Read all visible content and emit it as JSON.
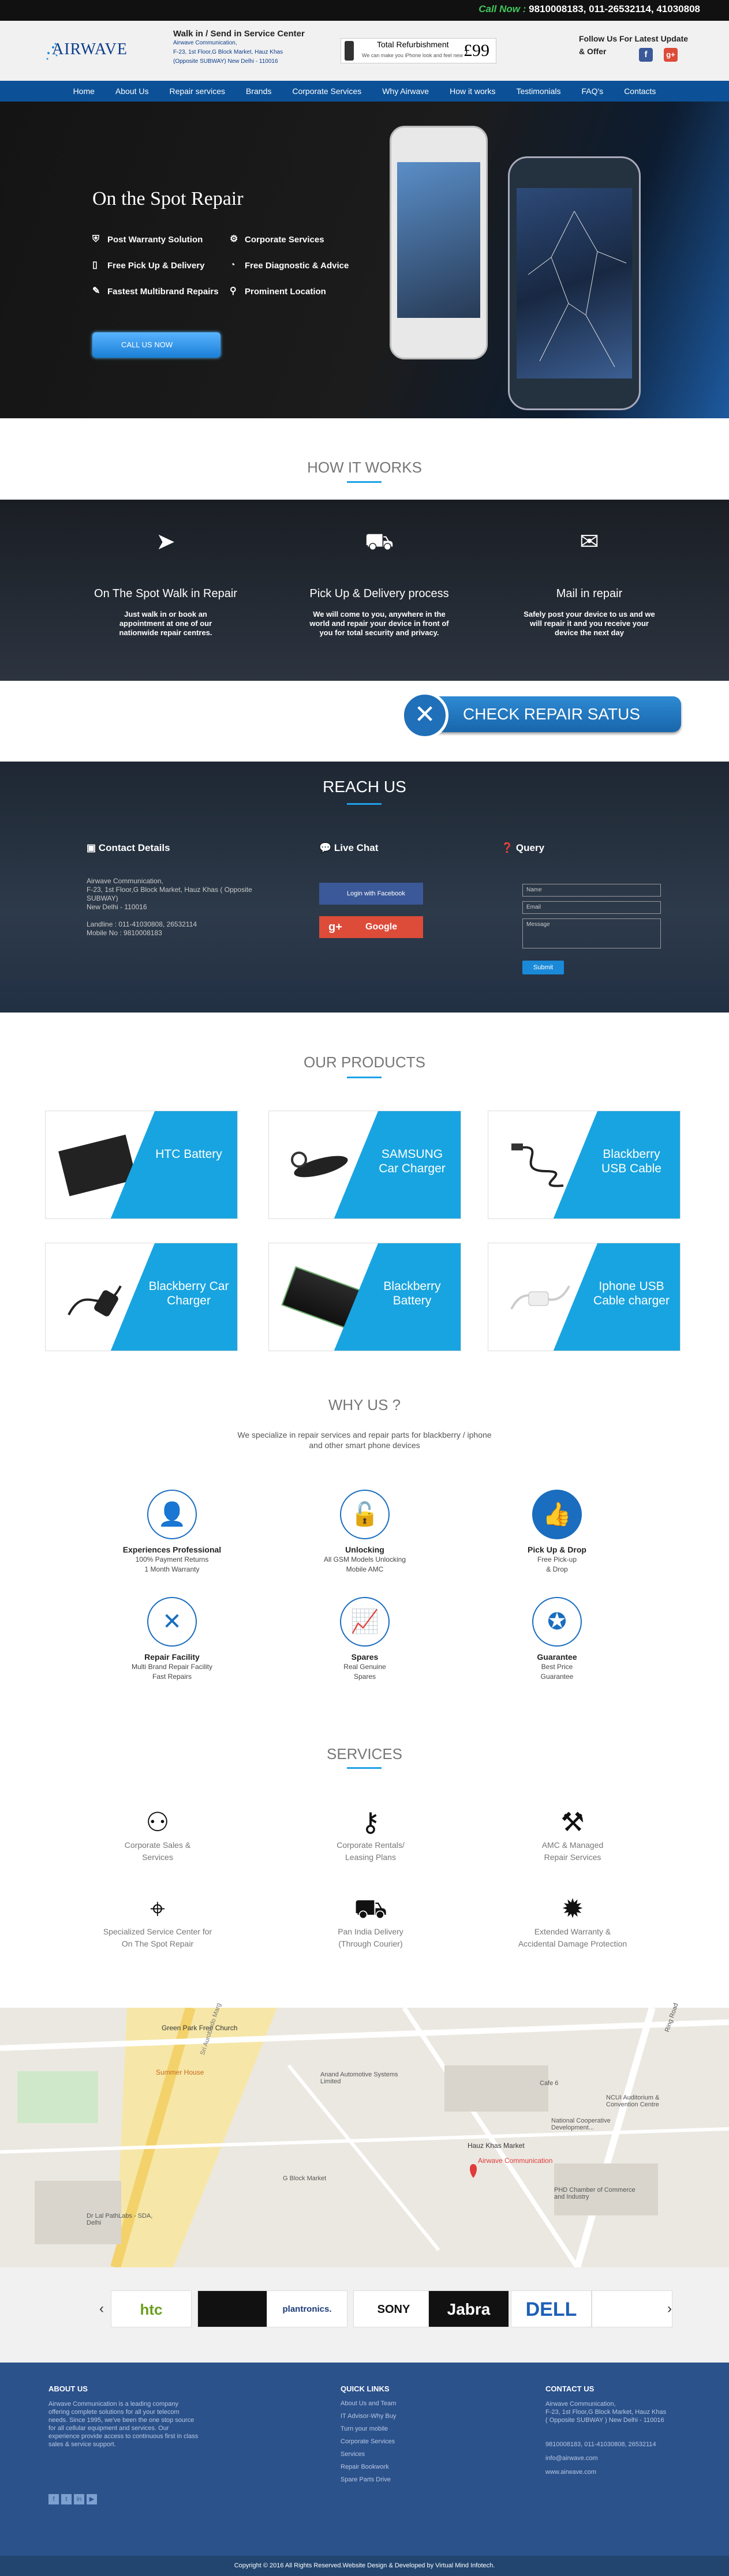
{
  "topbar": {
    "call_label": "Call Now :",
    "call_numbers": "9810008183, 011-26532114, 41030808"
  },
  "header": {
    "logo": "AIRWAVE",
    "walkin_title": "Walk in / Send in Service Center",
    "walkin_line1": "Airwave Communication,",
    "walkin_line2": "F-23, 1st Floor,G Block Market, Hauz Khas",
    "walkin_line3": "(Opposite SUBWAY) New Delhi - 110016",
    "refurb_title": "Total Refurbishment",
    "refurb_sub": "We can make you iPhone look and feel new",
    "refurb_price": "£99",
    "follow1": "Follow Us For Latest Update",
    "follow2": "& Offer",
    "fb": "f",
    "gp": "g+"
  },
  "nav": [
    "Home",
    "About Us",
    "Repair services",
    "Brands",
    "Corporate Services",
    "Why Airwave",
    "How it works",
    "Testimonials",
    "FAQ's",
    "Contacts"
  ],
  "hero": {
    "title": "On the Spot Repair",
    "features": [
      "Post Warranty Solution",
      "Corporate Services",
      "Free Pick Up & Delivery",
      "Free Diagnostic & Advice",
      "Fastest Multibrand Repairs",
      "Prominent Location"
    ],
    "cta": "CALL US NOW"
  },
  "how": {
    "title": "HOW IT WORKS",
    "steps": [
      {
        "title": "On The Spot Walk in Repair",
        "text": "Just walk in or book an appointment at one of our nationwide repair centres."
      },
      {
        "title": "Pick Up & Delivery process",
        "text": "We will come to you, anywhere in the world and repair your device in front of you for total security and privacy."
      },
      {
        "title": "Mail in repair",
        "text": "Safely post your device to us and we will repair it and you receive your device the next day"
      }
    ]
  },
  "check": {
    "label": "CHECK REPAIR SATUS"
  },
  "reach": {
    "title": "REACH US",
    "contact_title": "Contact Details",
    "contact_lines": [
      "Airwave Communication,",
      "F-23, 1st Floor,G Block Market, Hauz Khas ( Opposite",
      "SUBWAY)",
      "New Delhi - 110016",
      "",
      "Landline : 011-41030808, 26532114",
      "Mobile No : 9810008183"
    ],
    "chat_title": "Live Chat",
    "fb_login": "Login with Facebook",
    "google": "Google",
    "query_title": "Query",
    "name_ph": "Name",
    "email_ph": "Email",
    "msg_ph": "Message",
    "submit": "Submit"
  },
  "products": {
    "title": "OUR PRODUCTS",
    "items": [
      "HTC Battery",
      "SAMSUNG Car Charger",
      "Blackberry USB Cable",
      "Blackberry Car Charger",
      "Blackberry Battery",
      "Iphone USB Cable charger"
    ]
  },
  "why": {
    "title": "WHY US ?",
    "intro1": "We specialize in repair services and repair parts for blackberry / iphone",
    "intro2": "and other smart phone devices",
    "items": [
      {
        "title": "Experiences Professional",
        "l1": "100% Payment Returns",
        "l2": "1 Month Warranty"
      },
      {
        "title": "Unlocking",
        "l1": "All GSM Models Unlocking",
        "l2": "Mobile AMC"
      },
      {
        "title": "Pick Up & Drop",
        "l1": "Free Pick-up",
        "l2": "& Drop"
      },
      {
        "title": "Repair Facility",
        "l1": "Multi Brand Repair Facility",
        "l2": "Fast Repairs"
      },
      {
        "title": "Spares",
        "l1": "Real Genuine",
        "l2": "Spares"
      },
      {
        "title": "Guarantee",
        "l1": "Best Price",
        "l2": "Guarantee"
      }
    ]
  },
  "services": {
    "title": "SERVICES",
    "items": [
      {
        "l1": "Corporate Sales &",
        "l2": "Services"
      },
      {
        "l1": "Corporate Rentals/",
        "l2": "Leasing Plans"
      },
      {
        "l1": "AMC & Managed",
        "l2": "Repair Services"
      },
      {
        "l1": "Specialized Service Center for",
        "l2": "On The Spot Repair"
      },
      {
        "l1": "Pan India Delivery",
        "l2": "(Through Courier)"
      },
      {
        "l1": "Extended Warranty &",
        "l2": "Accidental Damage Protection"
      }
    ]
  },
  "map": {
    "labels": [
      "Green Park Free Church",
      "Summer House",
      "Anand Automotive Systems Limited",
      "G Block Market",
      "Dr Lal PathLabs - SDA, Delhi",
      "Sri Aurobindo Marg",
      "Hauz Khas Market",
      "Airwave Communication",
      "Cafe 6",
      "NCUI Auditorium & Convention Centre",
      "National Cooperative Development...",
      "PHD Chamber of Commerce and Industry",
      "Ring Road"
    ]
  },
  "brands": [
    "htc",
    "",
    "plantronics.",
    "SONY",
    "Jabra",
    "DELL",
    ""
  ],
  "footer": {
    "about_title": "ABOUT US",
    "about_text": "Airwave Communication is a leading company offering complete solutions for all your telecom needs. Since 1995, we've been the one stop source for all cellular equipment and services. Our experience provide access to continuous first in class sales & service support.",
    "links_title": "QUICK LINKS",
    "links": [
      "About Us and Team",
      "IT Advisor-Why Buy",
      "Turn your mobile",
      "Corporate Services",
      "Services",
      "Repair Bookwork",
      "Spare Parts Drive"
    ],
    "contact_title": "CONTACT US",
    "contact_lines": [
      "Airwave Communication,",
      "F-23, 1st Floor,G Block Market, Hauz Khas",
      "( Opposite SUBWAY ) New Delhi - 110016",
      "",
      "9810008183, 011-41030808, 26532114",
      "info@airwave.com",
      "www.airwave.com"
    ]
  },
  "copyright": "Copyright © 2016 All Rights Reserved.Website Design & Developed by Virtual Mind Infotech."
}
